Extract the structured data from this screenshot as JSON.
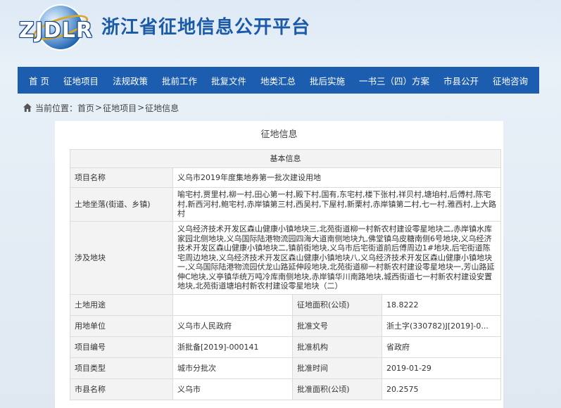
{
  "site": {
    "logo_text": "ZJDLR",
    "title": "浙江省征地信息公开平台"
  },
  "nav": [
    {
      "label": "首 页",
      "name": "nav-home"
    },
    {
      "label": "征地项目",
      "name": "nav-projects"
    },
    {
      "label": "法规政策",
      "name": "nav-policy"
    },
    {
      "label": "批前工作",
      "name": "nav-pre-approval"
    },
    {
      "label": "批复文件",
      "name": "nav-approval-docs"
    },
    {
      "label": "地类汇总",
      "name": "nav-land-summary"
    },
    {
      "label": "批后实施",
      "name": "nav-post-approval"
    },
    {
      "label": "一书三（四）方案",
      "name": "nav-plans"
    },
    {
      "label": "市县公开",
      "name": "nav-city-county"
    },
    {
      "label": "征地咨询",
      "name": "nav-consult"
    }
  ],
  "breadcrumb": {
    "prefix": "当前位置：",
    "items": [
      "首页",
      "征地项目",
      "征地信息"
    ],
    "separator": ">"
  },
  "panel": {
    "title": "征地信息",
    "section": "基本信息"
  },
  "fields": {
    "project_name": {
      "label": "项目名称",
      "value": "义乌市2019年度集地券第一批次建设用地"
    },
    "location": {
      "label": "土地坐落(街道、乡镇)",
      "value": "喻宅村,贾里村,柳一村,田心第一村,殿下村,国有,东宅村,楼下张村,祥贝村,塘垍村,后傅村,陈宅村,新西河村,鲍宅村,赤岸镇第三村,西吴村,下屋村,新栗村,赤岸镇第二村,七一村,雅西村,上大路村"
    },
    "plots": {
      "label": "涉及地块",
      "value": "义乌经济技术开发区森山健康小镇地块三,北苑街道柳一村新农村建设零星地块二,赤岸镇水库家园北侧地块,义乌国际陆港物流园四海大道南侧地块九,佛堂镇乌皮糖南侧6号地块,义乌经济技术开发区森山健康小镇地块二,镇前街地块,义乌市后宅街道前后傅周边1#地块,后宅街道陈宅周边地块,义乌经济技术开发区森山健康小镇地块八,义乌经济技术开发区森山健康小镇地块一,义乌国际陆港物流园伏龙山路延伸段地块,北苑街道柳一村新农村建设零星地块一,芳山路延伸C地块,义亭镇华统万吨冷库南侧地块,赤岸镇华川南路地块,城西街道七一村新农村建设安置地块,北苑街道塘垍村新农村建设零星地块（二）"
    },
    "land_use": {
      "label": "土地用途",
      "value": ""
    },
    "area": {
      "label": "征地面积(公顷)",
      "value": "18.8222"
    },
    "land_unit": {
      "label": "用地单位",
      "value": "义乌市人民政府"
    },
    "approval_no": {
      "label": "批准文号",
      "value": "浙土字(330782)J[2019]-0..."
    },
    "project_no": {
      "label": "项目编号",
      "value": "浙批备[2019]-000141"
    },
    "approval_org": {
      "label": "批准机构",
      "value": "省政府"
    },
    "project_type": {
      "label": "项目类型",
      "value": "城市分批次"
    },
    "approval_time": {
      "label": "批准时间",
      "value": "2019-01-29"
    },
    "city_county": {
      "label": "市县名称",
      "value": "义乌市"
    },
    "approval_area": {
      "label": "批准面积(公顷)",
      "value": "20.2575"
    }
  },
  "colors": {
    "nav_bg": "#1c5db0",
    "title_blue": "#1a5aa8",
    "label_bg": "#f3f3f3"
  }
}
